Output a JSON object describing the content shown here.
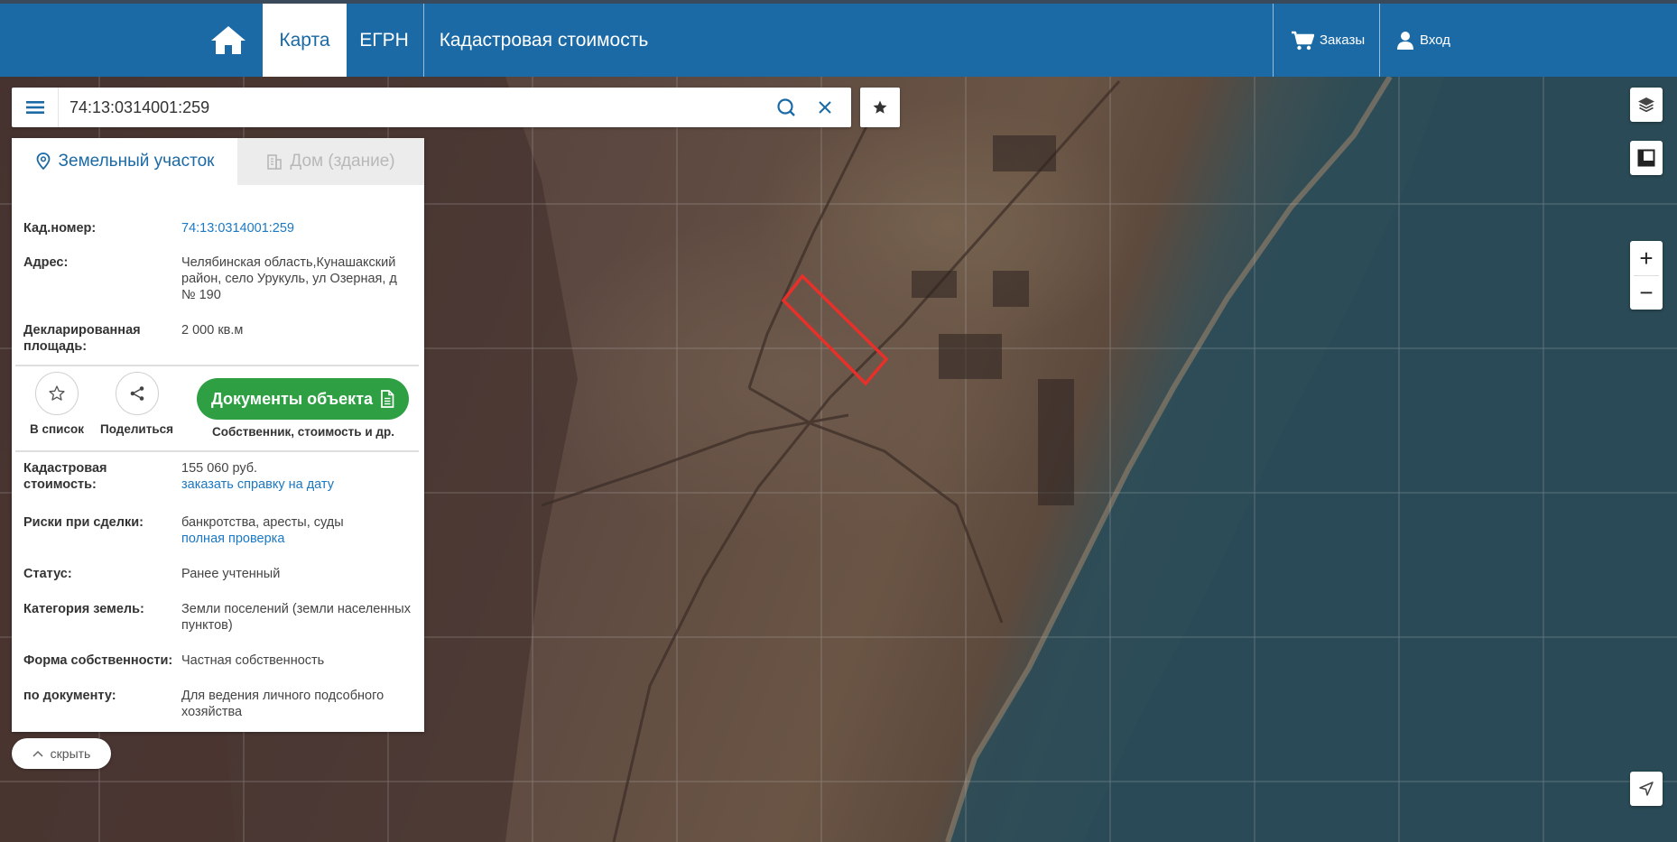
{
  "header": {
    "home_icon": "home-icon",
    "tabs": [
      {
        "label": "Карта",
        "active": true
      },
      {
        "label": "ЕГРН",
        "active": false
      },
      {
        "label": "Кадастровая стоимость",
        "active": false
      }
    ],
    "orders_label": "Заказы",
    "login_label": "Вход",
    "accent_color": "#1b6aa5"
  },
  "search": {
    "value": "74:13:0314001:259",
    "icons": [
      "menu-icon",
      "search-icon",
      "clear-icon",
      "star-icon"
    ]
  },
  "panel": {
    "tabs": {
      "land": "Земельный участок",
      "building": "Дом (здание)"
    },
    "cad_number": {
      "label": "Кад.номер:",
      "value": "74:13:0314001:259"
    },
    "address": {
      "label": "Адрес:",
      "value": "Челябинская область,Кунашакский район, село Урукуль, ул Озерная, д № 190"
    },
    "declared_area": {
      "label": "Декларированная площадь:",
      "value": "2 000 кв.м"
    },
    "actions": {
      "add_to_list": "В список",
      "share": "Поделиться",
      "documents_button": "Документы объекта",
      "documents_sub": "Собственник, стоимость и др."
    },
    "cad_value": {
      "label": "Кадастровая стоимость:",
      "value": "155 060 руб.",
      "link": "заказать справку на дату"
    },
    "risks": {
      "label": "Риски при сделки:",
      "value": "банкротства, аресты, суды",
      "link": "полная проверка"
    },
    "status": {
      "label": "Статус:",
      "value": "Ранее учтенный"
    },
    "land_category": {
      "label": "Категория земель:",
      "value": "Земли поселений (земли населенных пунктов)"
    },
    "ownership": {
      "label": "Форма собственности:",
      "value": "Частная собственность"
    },
    "by_document": {
      "label": "по документу:",
      "value": "Для ведения личного подсобного хозяйства"
    },
    "button_color": "#2ea043"
  },
  "hide_button": {
    "label": "скрыть"
  },
  "map_controls": {
    "icons": [
      "layers-icon",
      "ruler-icon",
      "zoom-in-icon",
      "zoom-out-icon",
      "locate-icon"
    ],
    "zoom_in": "+",
    "zoom_out": "−"
  }
}
